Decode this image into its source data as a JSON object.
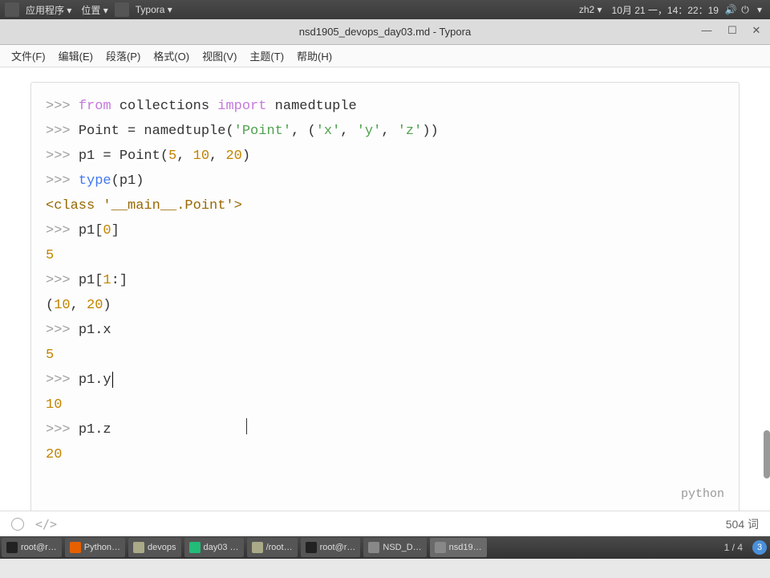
{
  "top": {
    "apps": "应用程序",
    "places": "位置",
    "app": "Typora",
    "ime": "zh2",
    "date": "10月 21 一，14：22：19"
  },
  "title": "nsd1905_devops_day03.md - Typora",
  "menu": {
    "file": "文件(F)",
    "edit": "编辑(E)",
    "para": "段落(P)",
    "format": "格式(O)",
    "view": "视图(V)",
    "theme": "主题(T)",
    "help": "帮助(H)"
  },
  "code": {
    "prompt": ">>>",
    "lang": "python",
    "l1": {
      "kw1": "from",
      "mod": "collections",
      "kw2": "import",
      "name": "namedtuple"
    },
    "l2": {
      "lhs": "Point = namedtuple(",
      "s1": "'Point'",
      "c": ", (",
      "s2": "'x'",
      "s3": "'y'",
      "s4": "'z'",
      "end": "))"
    },
    "l3": {
      "a": "p1 = Point(",
      "n1": "5",
      "n2": "10",
      "n3": "20",
      "end": ")"
    },
    "l4": {
      "fn": "type",
      "arg": "(p1)"
    },
    "l5": "<class '__main__.Point'>",
    "l6": {
      "a": "p1[",
      "n": "0",
      "b": "]"
    },
    "l7": "5",
    "l8": {
      "a": "p1[",
      "n": "1",
      "b": ":]"
    },
    "l9": {
      "a": "(",
      "n1": "10",
      "c": ", ",
      "n2": "20",
      "b": ")"
    },
    "l10": "p1.x",
    "l11": "5",
    "l12": "p1.y",
    "l13": "10",
    "l14": "p1.z",
    "l15": "20"
  },
  "status": {
    "words": "504 词"
  },
  "tasks": {
    "t1": "root@r…",
    "t2": "Python…",
    "t3": "devops",
    "t4": "day03 …",
    "t5": "/root…",
    "t6": "root@r…",
    "t7": "NSD_D…",
    "t8": "nsd19…",
    "pager": "1 / 4",
    "ws": "3"
  }
}
